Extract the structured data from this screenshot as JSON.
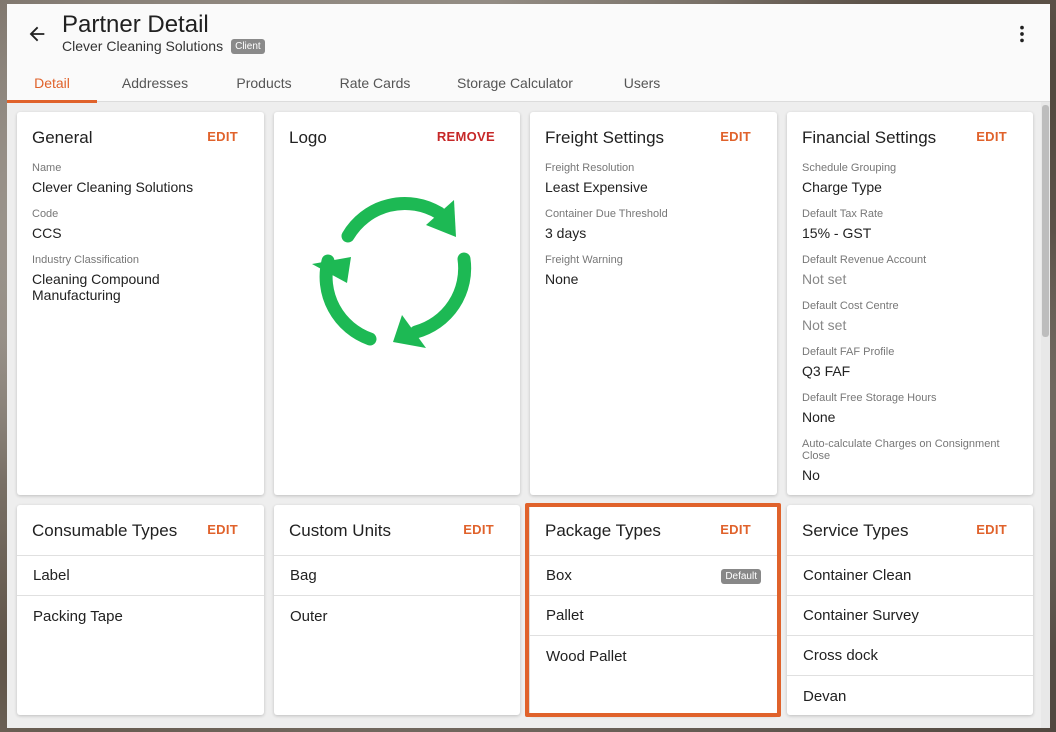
{
  "header": {
    "title": "Partner Detail",
    "subtitle": "Clever Cleaning Solutions",
    "badge": "Client"
  },
  "tabs": [
    {
      "label": "Detail",
      "active": true
    },
    {
      "label": "Addresses"
    },
    {
      "label": "Products"
    },
    {
      "label": "Rate Cards"
    },
    {
      "label": "Storage Calculator"
    },
    {
      "label": "Users"
    }
  ],
  "general": {
    "title": "General",
    "action": "EDIT",
    "fields": [
      {
        "label": "Name",
        "value": "Clever Cleaning Solutions"
      },
      {
        "label": "Code",
        "value": "CCS"
      },
      {
        "label": "Industry Classification",
        "value": "Cleaning Compound Manufacturing"
      }
    ]
  },
  "logo": {
    "title": "Logo",
    "action": "REMOVE",
    "icon": "recycle-arrows-icon",
    "color": "#1db954"
  },
  "freight": {
    "title": "Freight Settings",
    "action": "EDIT",
    "fields": [
      {
        "label": "Freight Resolution",
        "value": "Least Expensive"
      },
      {
        "label": "Container Due Threshold",
        "value": "3 days"
      },
      {
        "label": "Freight Warning",
        "value": "None"
      }
    ]
  },
  "financial": {
    "title": "Financial Settings",
    "action": "EDIT",
    "fields": [
      {
        "label": "Schedule Grouping",
        "value": "Charge Type"
      },
      {
        "label": "Default Tax Rate",
        "value": "15% - GST"
      },
      {
        "label": "Default Revenue Account",
        "value": "Not set"
      },
      {
        "label": "Default Cost Centre",
        "value": "Not set"
      },
      {
        "label": "Default FAF Profile",
        "value": "Q3 FAF"
      },
      {
        "label": "Default Free Storage Hours",
        "value": "None"
      },
      {
        "label": "Auto-calculate Charges on Consignment Close",
        "value": "No"
      }
    ]
  },
  "consumable": {
    "title": "Consumable Types",
    "action": "EDIT",
    "items": [
      "Label",
      "Packing Tape"
    ]
  },
  "custom_units": {
    "title": "Custom Units",
    "action": "EDIT",
    "items": [
      "Bag",
      "Outer"
    ]
  },
  "package_types": {
    "title": "Package Types",
    "action": "EDIT",
    "items": [
      "Box",
      "Pallet",
      "Wood Pallet"
    ],
    "default_badge": "Default"
  },
  "service_types": {
    "title": "Service Types",
    "action": "EDIT",
    "items": [
      "Container Clean",
      "Container Survey",
      "Cross dock",
      "Devan"
    ]
  },
  "colors": {
    "accent": "#e0622b",
    "remove": "#c62828",
    "highlight": "#e0622b"
  }
}
